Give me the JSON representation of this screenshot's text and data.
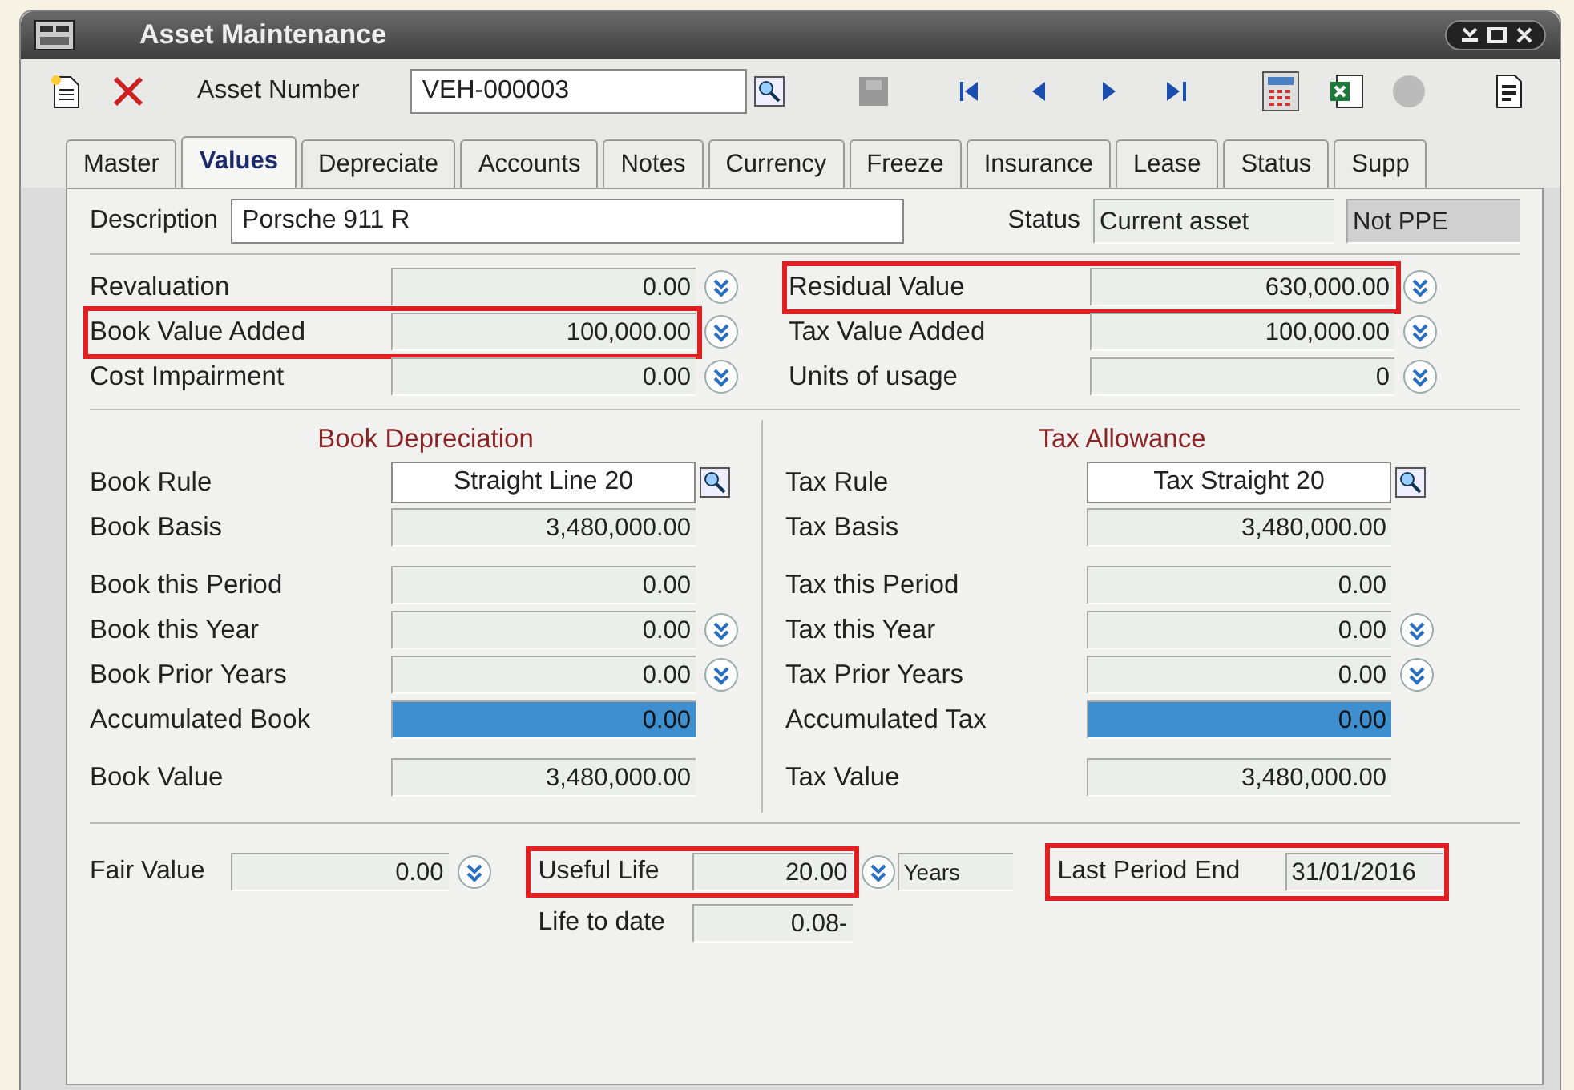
{
  "window": {
    "title": "Asset Maintenance"
  },
  "toolbar": {
    "asset_number_label": "Asset Number",
    "asset_number": "VEH-000003"
  },
  "tabs": [
    {
      "label": "Master",
      "selected": false
    },
    {
      "label": "Values",
      "selected": true
    },
    {
      "label": "Depreciate",
      "selected": false
    },
    {
      "label": "Accounts",
      "selected": false
    },
    {
      "label": "Notes",
      "selected": false
    },
    {
      "label": "Currency",
      "selected": false
    },
    {
      "label": "Freeze",
      "selected": false
    },
    {
      "label": "Insurance",
      "selected": false
    },
    {
      "label": "Lease",
      "selected": false
    },
    {
      "label": "Status",
      "selected": false
    },
    {
      "label": "Supp",
      "selected": false
    }
  ],
  "description": {
    "label": "Description",
    "value": "Porsche 911 R",
    "status_label": "Status",
    "status": "Current asset",
    "ppe": "Not PPE"
  },
  "values_left": [
    {
      "label": "Revaluation",
      "value": "0.00",
      "highlighted": false
    },
    {
      "label": "Book Value Added",
      "value": "100,000.00",
      "highlighted": true
    },
    {
      "label": "Cost Impairment",
      "value": "0.00",
      "highlighted": false
    }
  ],
  "values_right": [
    {
      "label": "Residual Value",
      "value": "630,000.00",
      "highlighted": true
    },
    {
      "label": "Tax Value Added",
      "value": "100,000.00",
      "highlighted": false
    },
    {
      "label": "Units of usage",
      "value": "0",
      "highlighted": false
    }
  ],
  "sections": [
    {
      "title": "Book Depreciation",
      "rule_label": "Book Rule",
      "rule": "Straight Line 20",
      "row_groups": [
        [
          {
            "label": "Book Basis",
            "value": "3,480,000.00",
            "kind": "plain",
            "dropdown": false
          }
        ],
        [
          {
            "label": "Book this Period",
            "value": "0.00",
            "kind": "plain",
            "dropdown": false
          },
          {
            "label": "Book this Year",
            "value": "0.00",
            "kind": "plain",
            "dropdown": true
          },
          {
            "label": "Book Prior Years",
            "value": "0.00",
            "kind": "plain",
            "dropdown": true
          },
          {
            "label": "Accumulated Book",
            "value": "0.00",
            "kind": "accumulated",
            "dropdown": false
          }
        ],
        [
          {
            "label": "Book Value",
            "value": "3,480,000.00",
            "kind": "plain",
            "dropdown": false
          }
        ]
      ]
    },
    {
      "title": "Tax Allowance",
      "rule_label": "Tax Rule",
      "rule": "Tax Straight 20",
      "row_groups": [
        [
          {
            "label": "Tax Basis",
            "value": "3,480,000.00",
            "kind": "plain",
            "dropdown": false
          }
        ],
        [
          {
            "label": "Tax this Period",
            "value": "0.00",
            "kind": "plain",
            "dropdown": false
          },
          {
            "label": "Tax this Year",
            "value": "0.00",
            "kind": "plain",
            "dropdown": true
          },
          {
            "label": "Tax Prior Years",
            "value": "0.00",
            "kind": "plain",
            "dropdown": true
          },
          {
            "label": "Accumulated Tax",
            "value": "0.00",
            "kind": "accumulated",
            "dropdown": false
          }
        ],
        [
          {
            "label": "Tax Value",
            "value": "3,480,000.00",
            "kind": "plain",
            "dropdown": false
          }
        ]
      ]
    }
  ],
  "bottom": {
    "fair_value_label": "Fair Value",
    "fair_value": "0.00",
    "useful_life_label": "Useful Life",
    "useful_life": "20.00",
    "useful_life_highlighted": true,
    "unit": "Years",
    "life_to_date_label": "Life to date",
    "life_to_date": "0.08-",
    "last_period_label": "Last Period End",
    "last_period": "31/01/2016",
    "last_period_highlighted": true
  }
}
